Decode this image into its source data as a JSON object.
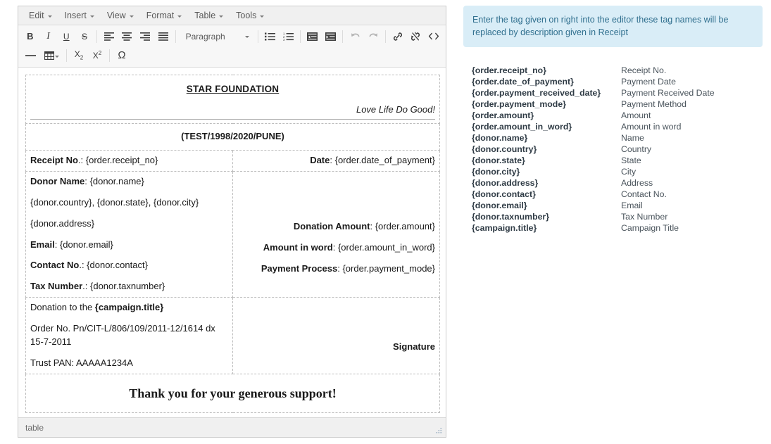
{
  "editor": {
    "menubar": [
      {
        "label": "Edit",
        "name": "menu-edit"
      },
      {
        "label": "Insert",
        "name": "menu-insert"
      },
      {
        "label": "View",
        "name": "menu-view"
      },
      {
        "label": "Format",
        "name": "menu-format"
      },
      {
        "label": "Table",
        "name": "menu-table"
      },
      {
        "label": "Tools",
        "name": "menu-tools"
      }
    ],
    "toolbar": {
      "bold": "B",
      "italic": "I",
      "underline": "U",
      "strikethrough": "S",
      "format_select": "Paragraph",
      "subscript": "X",
      "subscript_sub": "2",
      "superscript": "X",
      "superscript_sup": "2",
      "special_char": "Ω"
    },
    "statusbar": {
      "path": "table"
    }
  },
  "receipt": {
    "org_title": "STAR FOUNDATION",
    "org_tagline": "Love Life Do Good!",
    "registration": "(TEST/1998/2020/PUNE)",
    "receipt_no_label": "Receipt No",
    "receipt_no_value": ".: {order.receipt_no}",
    "date_label": "Date",
    "date_value": ": {order.date_of_payment}",
    "donor_name_label": "Donor Name",
    "donor_name_value": ": {donor.name}",
    "donor_location": "{donor.country}, {donor.state}, {donor.city}",
    "donor_address": "{donor.address}",
    "email_label": "Email",
    "email_value": ": {donor.email}",
    "contact_label": "Contact No",
    "contact_value": ".: {donor.contact}",
    "tax_label": "Tax Number",
    "tax_value": ".: {donor.taxnumber}",
    "donation_amount_label": "Donation Amount",
    "donation_amount_value": ": {order.amount}",
    "amount_in_word_label": "Amount in word",
    "amount_in_word_value": ": {order.amount_in_word}",
    "payment_process_label": "Payment Process",
    "payment_process_value": ": {order.payment_mode}",
    "donation_to_prefix": "Donation to the ",
    "campaign_tag": "{campaign.title}",
    "order_no_line": "Order No. Pn/CIT-L/806/109/2011-12/1614 dx 15-7-2011",
    "trust_pan_line": "Trust PAN: AAAAA1234A",
    "signature": "Signature",
    "thanks": "Thank you for your generous support!"
  },
  "info_panel": {
    "notice": "Enter the tag given on right into the editor these tag names will be replaced by description given in Receipt",
    "tags": [
      {
        "tag": "{order.receipt_no}",
        "description": "Receipt No."
      },
      {
        "tag": "{order.date_of_payment}",
        "description": "Payment Date"
      },
      {
        "tag": "{order.payment_received_date}",
        "description": "Payment Received Date"
      },
      {
        "tag": "{order.payment_mode}",
        "description": "Payment Method"
      },
      {
        "tag": "{order.amount}",
        "description": "Amount"
      },
      {
        "tag": "{order.amount_in_word}",
        "description": "Amount in word"
      },
      {
        "tag": "{donor.name}",
        "description": "Name"
      },
      {
        "tag": "{donor.country}",
        "description": "Country"
      },
      {
        "tag": "{donor.state}",
        "description": "State"
      },
      {
        "tag": "{donor.city}",
        "description": "City"
      },
      {
        "tag": "{donor.address}",
        "description": "Address"
      },
      {
        "tag": "{donor.contact}",
        "description": "Contact No."
      },
      {
        "tag": "{donor.email}",
        "description": "Email"
      },
      {
        "tag": "{donor.taxnumber}",
        "description": "Tax Number"
      },
      {
        "tag": "{campaign.title}",
        "description": "Campaign Title"
      }
    ]
  },
  "colors": {
    "info_bg": "#d9edf7",
    "info_text": "#31708f",
    "toolbar_bg": "#f7f7f7",
    "menubar_bg": "#f0f0f0",
    "border": "#cccccc"
  }
}
